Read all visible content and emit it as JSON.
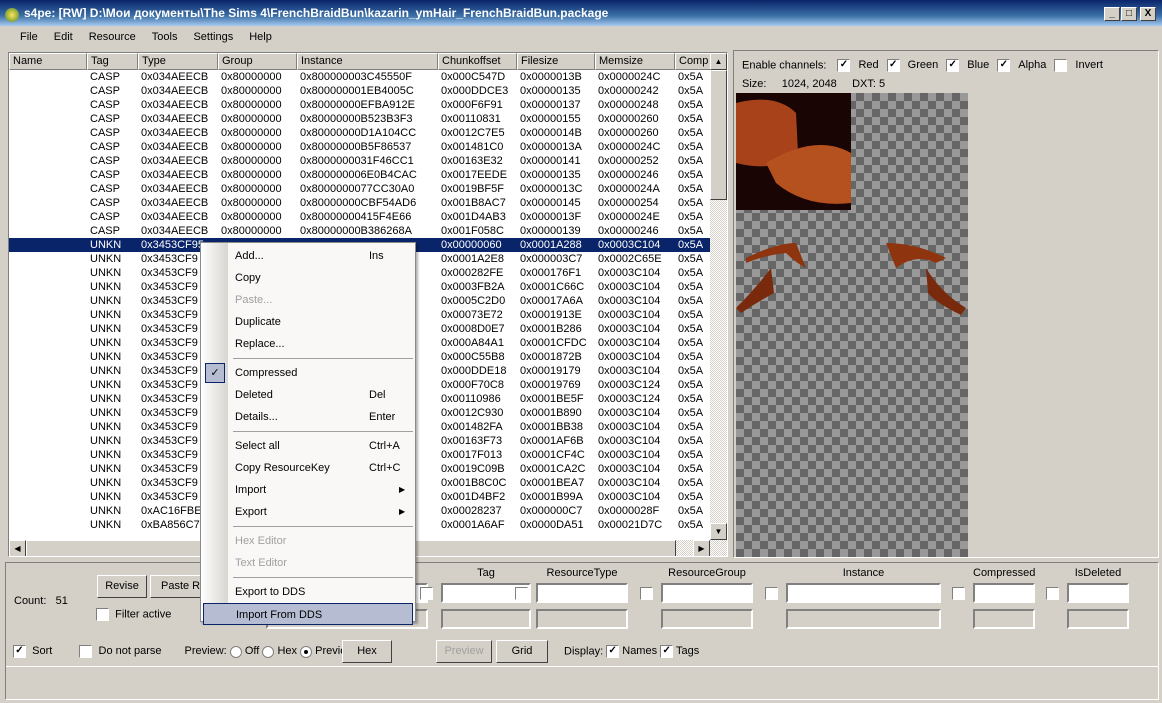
{
  "window": {
    "title": "s4pe: [RW] D:\\Мои документы\\The Sims 4\\FrenchBraidBun\\kazarin_ymHair_FrenchBraidBun.package",
    "minimize": "_",
    "maximize": "□",
    "close": "X"
  },
  "menubar": [
    "File",
    "Edit",
    "Resource",
    "Tools",
    "Settings",
    "Help"
  ],
  "table": {
    "columns": [
      "Name",
      "Tag",
      "Type",
      "Group",
      "Instance",
      "Chunkoffset",
      "Filesize",
      "Memsize",
      "Comp"
    ],
    "selected_index": 12,
    "rows": [
      [
        "",
        "CASP",
        "0x034AEECB",
        "0x80000000",
        "0x800000003C45550F",
        "0x000C547D",
        "0x0000013B",
        "0x0000024C",
        "0x5A"
      ],
      [
        "",
        "CASP",
        "0x034AEECB",
        "0x80000000",
        "0x800000001EB4005C",
        "0x000DDCE3",
        "0x00000135",
        "0x00000242",
        "0x5A"
      ],
      [
        "",
        "CASP",
        "0x034AEECB",
        "0x80000000",
        "0x80000000EFBA912E",
        "0x000F6F91",
        "0x00000137",
        "0x00000248",
        "0x5A"
      ],
      [
        "",
        "CASP",
        "0x034AEECB",
        "0x80000000",
        "0x80000000B523B3F3",
        "0x00110831",
        "0x00000155",
        "0x00000260",
        "0x5A"
      ],
      [
        "",
        "CASP",
        "0x034AEECB",
        "0x80000000",
        "0x80000000D1A104CC",
        "0x0012C7E5",
        "0x0000014B",
        "0x00000260",
        "0x5A"
      ],
      [
        "",
        "CASP",
        "0x034AEECB",
        "0x80000000",
        "0x80000000B5F86537",
        "0x001481C0",
        "0x0000013A",
        "0x0000024C",
        "0x5A"
      ],
      [
        "",
        "CASP",
        "0x034AEECB",
        "0x80000000",
        "0x8000000031F46CC1",
        "0x00163E32",
        "0x00000141",
        "0x00000252",
        "0x5A"
      ],
      [
        "",
        "CASP",
        "0x034AEECB",
        "0x80000000",
        "0x800000006E0B4CAC",
        "0x0017EEDE",
        "0x00000135",
        "0x00000246",
        "0x5A"
      ],
      [
        "",
        "CASP",
        "0x034AEECB",
        "0x80000000",
        "0x8000000077CC30A0",
        "0x0019BF5F",
        "0x0000013C",
        "0x0000024A",
        "0x5A"
      ],
      [
        "",
        "CASP",
        "0x034AEECB",
        "0x80000000",
        "0x80000000CBF54AD6",
        "0x001B8AC7",
        "0x00000145",
        "0x00000254",
        "0x5A"
      ],
      [
        "",
        "CASP",
        "0x034AEECB",
        "0x80000000",
        "0x80000000415F4E66",
        "0x001D4AB3",
        "0x0000013F",
        "0x0000024E",
        "0x5A"
      ],
      [
        "",
        "CASP",
        "0x034AEECB",
        "0x80000000",
        "0x80000000B386268A",
        "0x001F058C",
        "0x00000139",
        "0x00000246",
        "0x5A"
      ],
      [
        "",
        "UNKN",
        "0x3453CF95",
        "",
        "",
        "0x00000060",
        "0x0001A288",
        "0x0003C104",
        "0x5A"
      ],
      [
        "",
        "UNKN",
        "0x3453CF9",
        "",
        "3",
        "0x0001A2E8",
        "0x000003C7",
        "0x0002C65E",
        "0x5A"
      ],
      [
        "",
        "UNKN",
        "0x3453CF9",
        "",
        "D",
        "0x000282FE",
        "0x000176F1",
        "0x0003C104",
        "0x5A"
      ],
      [
        "",
        "UNKN",
        "0x3453CF9",
        "",
        "B",
        "0x0003FB2A",
        "0x0001C66C",
        "0x0003C104",
        "0x5A"
      ],
      [
        "",
        "UNKN",
        "0x3453CF9",
        "",
        "",
        "0x0005C2D0",
        "0x00017A6A",
        "0x0003C104",
        "0x5A"
      ],
      [
        "",
        "UNKN",
        "0x3453CF9",
        "",
        "",
        "0x00073E72",
        "0x0001913E",
        "0x0003C104",
        "0x5A"
      ],
      [
        "",
        "UNKN",
        "0x3453CF9",
        "",
        "6",
        "0x0008D0E7",
        "0x0001B286",
        "0x0003C104",
        "0x5A"
      ],
      [
        "",
        "UNKN",
        "0x3453CF9",
        "",
        "7",
        "0x000A84A1",
        "0x0001CFDC",
        "0x0003C104",
        "0x5A"
      ],
      [
        "",
        "UNKN",
        "0x3453CF9",
        "",
        "C",
        "0x000C55B8",
        "0x0001872B",
        "0x0003C104",
        "0x5A"
      ],
      [
        "",
        "UNKN",
        "0x3453CF9",
        "",
        "",
        "0x000DDE18",
        "0x00019179",
        "0x0003C104",
        "0x5A"
      ],
      [
        "",
        "UNKN",
        "0x3453CF9",
        "",
        "3",
        "0x000F70C8",
        "0x00019769",
        "0x0003C124",
        "0x5A"
      ],
      [
        "",
        "UNKN",
        "0x3453CF9",
        "",
        "C",
        "0x00110986",
        "0x0001BE5F",
        "0x0003C124",
        "0x5A"
      ],
      [
        "",
        "UNKN",
        "0x3453CF9",
        "",
        "",
        "0x0012C930",
        "0x0001B890",
        "0x0003C104",
        "0x5A"
      ],
      [
        "",
        "UNKN",
        "0x3453CF9",
        "",
        "",
        "0x001482FA",
        "0x0001BB38",
        "0x0003C104",
        "0x5A"
      ],
      [
        "",
        "UNKN",
        "0x3453CF9",
        "",
        "",
        "0x00163F73",
        "0x0001AF6B",
        "0x0003C104",
        "0x5A"
      ],
      [
        "",
        "UNKN",
        "0x3453CF9",
        "",
        "0",
        "0x0017F013",
        "0x0001CF4C",
        "0x0003C104",
        "0x5A"
      ],
      [
        "",
        "UNKN",
        "0x3453CF9",
        "",
        "",
        "0x0019C09B",
        "0x0001CA2C",
        "0x0003C104",
        "0x5A"
      ],
      [
        "",
        "UNKN",
        "0x3453CF9",
        "",
        "",
        "0x001B8C0C",
        "0x0001BEA7",
        "0x0003C104",
        "0x5A"
      ],
      [
        "",
        "UNKN",
        "0x3453CF9",
        "",
        "",
        "0x001D4BF2",
        "0x0001B99A",
        "0x0003C104",
        "0x5A"
      ],
      [
        "",
        "UNKN",
        "0xAC16FBE",
        "",
        "0",
        "0x00028237",
        "0x000000C7",
        "0x0000028F",
        "0x5A"
      ],
      [
        "",
        "UNKN",
        "0xBA856C7",
        "",
        "3",
        "0x0001A6AF",
        "0x0000DA51",
        "0x00021D7C",
        "0x5A"
      ]
    ]
  },
  "preview": {
    "enable_label": "Enable channels:",
    "channels": [
      {
        "label": "Red",
        "checked": true
      },
      {
        "label": "Green",
        "checked": true
      },
      {
        "label": "Blue",
        "checked": true
      },
      {
        "label": "Alpha",
        "checked": true
      },
      {
        "label": "Invert",
        "checked": false
      }
    ],
    "size_label": "Size:",
    "size_value": "1024, 2048",
    "dxt": "DXT: 5"
  },
  "context_menu": [
    {
      "label": "Add...",
      "shortcut": "Ins"
    },
    {
      "label": "Copy"
    },
    {
      "label": "Paste...",
      "disabled": true
    },
    {
      "label": "Duplicate"
    },
    {
      "label": "Replace..."
    },
    {
      "sep": true
    },
    {
      "label": "Compressed",
      "checked": true
    },
    {
      "label": "Deleted",
      "shortcut": "Del"
    },
    {
      "label": "Details...",
      "shortcut": "Enter"
    },
    {
      "sep": true
    },
    {
      "label": "Select all",
      "shortcut": "Ctrl+A"
    },
    {
      "label": "Copy ResourceKey",
      "shortcut": "Ctrl+C"
    },
    {
      "label": "Import",
      "submenu": true
    },
    {
      "label": "Export",
      "submenu": true
    },
    {
      "sep": true
    },
    {
      "label": "Hex Editor",
      "disabled": true
    },
    {
      "label": "Text Editor",
      "disabled": true
    },
    {
      "sep": true
    },
    {
      "label": "Export to DDS"
    },
    {
      "label": "Import From DDS",
      "highlighted": true
    }
  ],
  "bottom": {
    "count_label": "Count:",
    "count": "51",
    "revise": "Revise",
    "paste_rk": "Paste RK",
    "filter_active": "Filter active",
    "filters": [
      {
        "label": "Tag"
      },
      {
        "label": "ResourceType"
      },
      {
        "label": "ResourceGroup"
      },
      {
        "label": "Instance"
      },
      {
        "label": "Compressed"
      },
      {
        "label": "IsDeleted"
      }
    ],
    "sort": "Sort",
    "do_not_parse": "Do not parse",
    "preview_label": "Preview:",
    "radio_off": "Off",
    "radio_hex": "Hex",
    "radio_preview": "Preview",
    "hex_btn": "Hex",
    "preview_btn": "Preview",
    "grid_btn": "Grid",
    "display_label": "Display:",
    "names": "Names",
    "tags": "Tags"
  }
}
